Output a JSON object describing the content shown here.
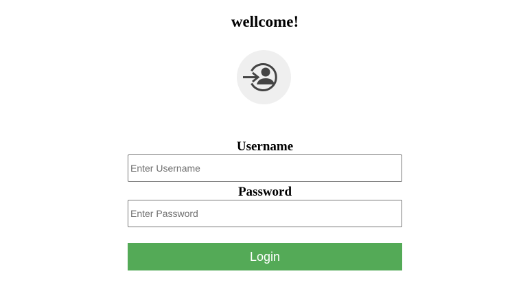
{
  "header": {
    "title": "wellcome!"
  },
  "avatar": {
    "icon": "login-user-icon"
  },
  "form": {
    "username_label": "Username",
    "username_placeholder": "Enter Username",
    "username_value": "",
    "password_label": "Password",
    "password_placeholder": "Enter Password",
    "password_value": "",
    "login_label": "Login"
  },
  "colors": {
    "login_button": "#54aa57",
    "avatar_background": "#efefef",
    "icon": "#444444"
  }
}
